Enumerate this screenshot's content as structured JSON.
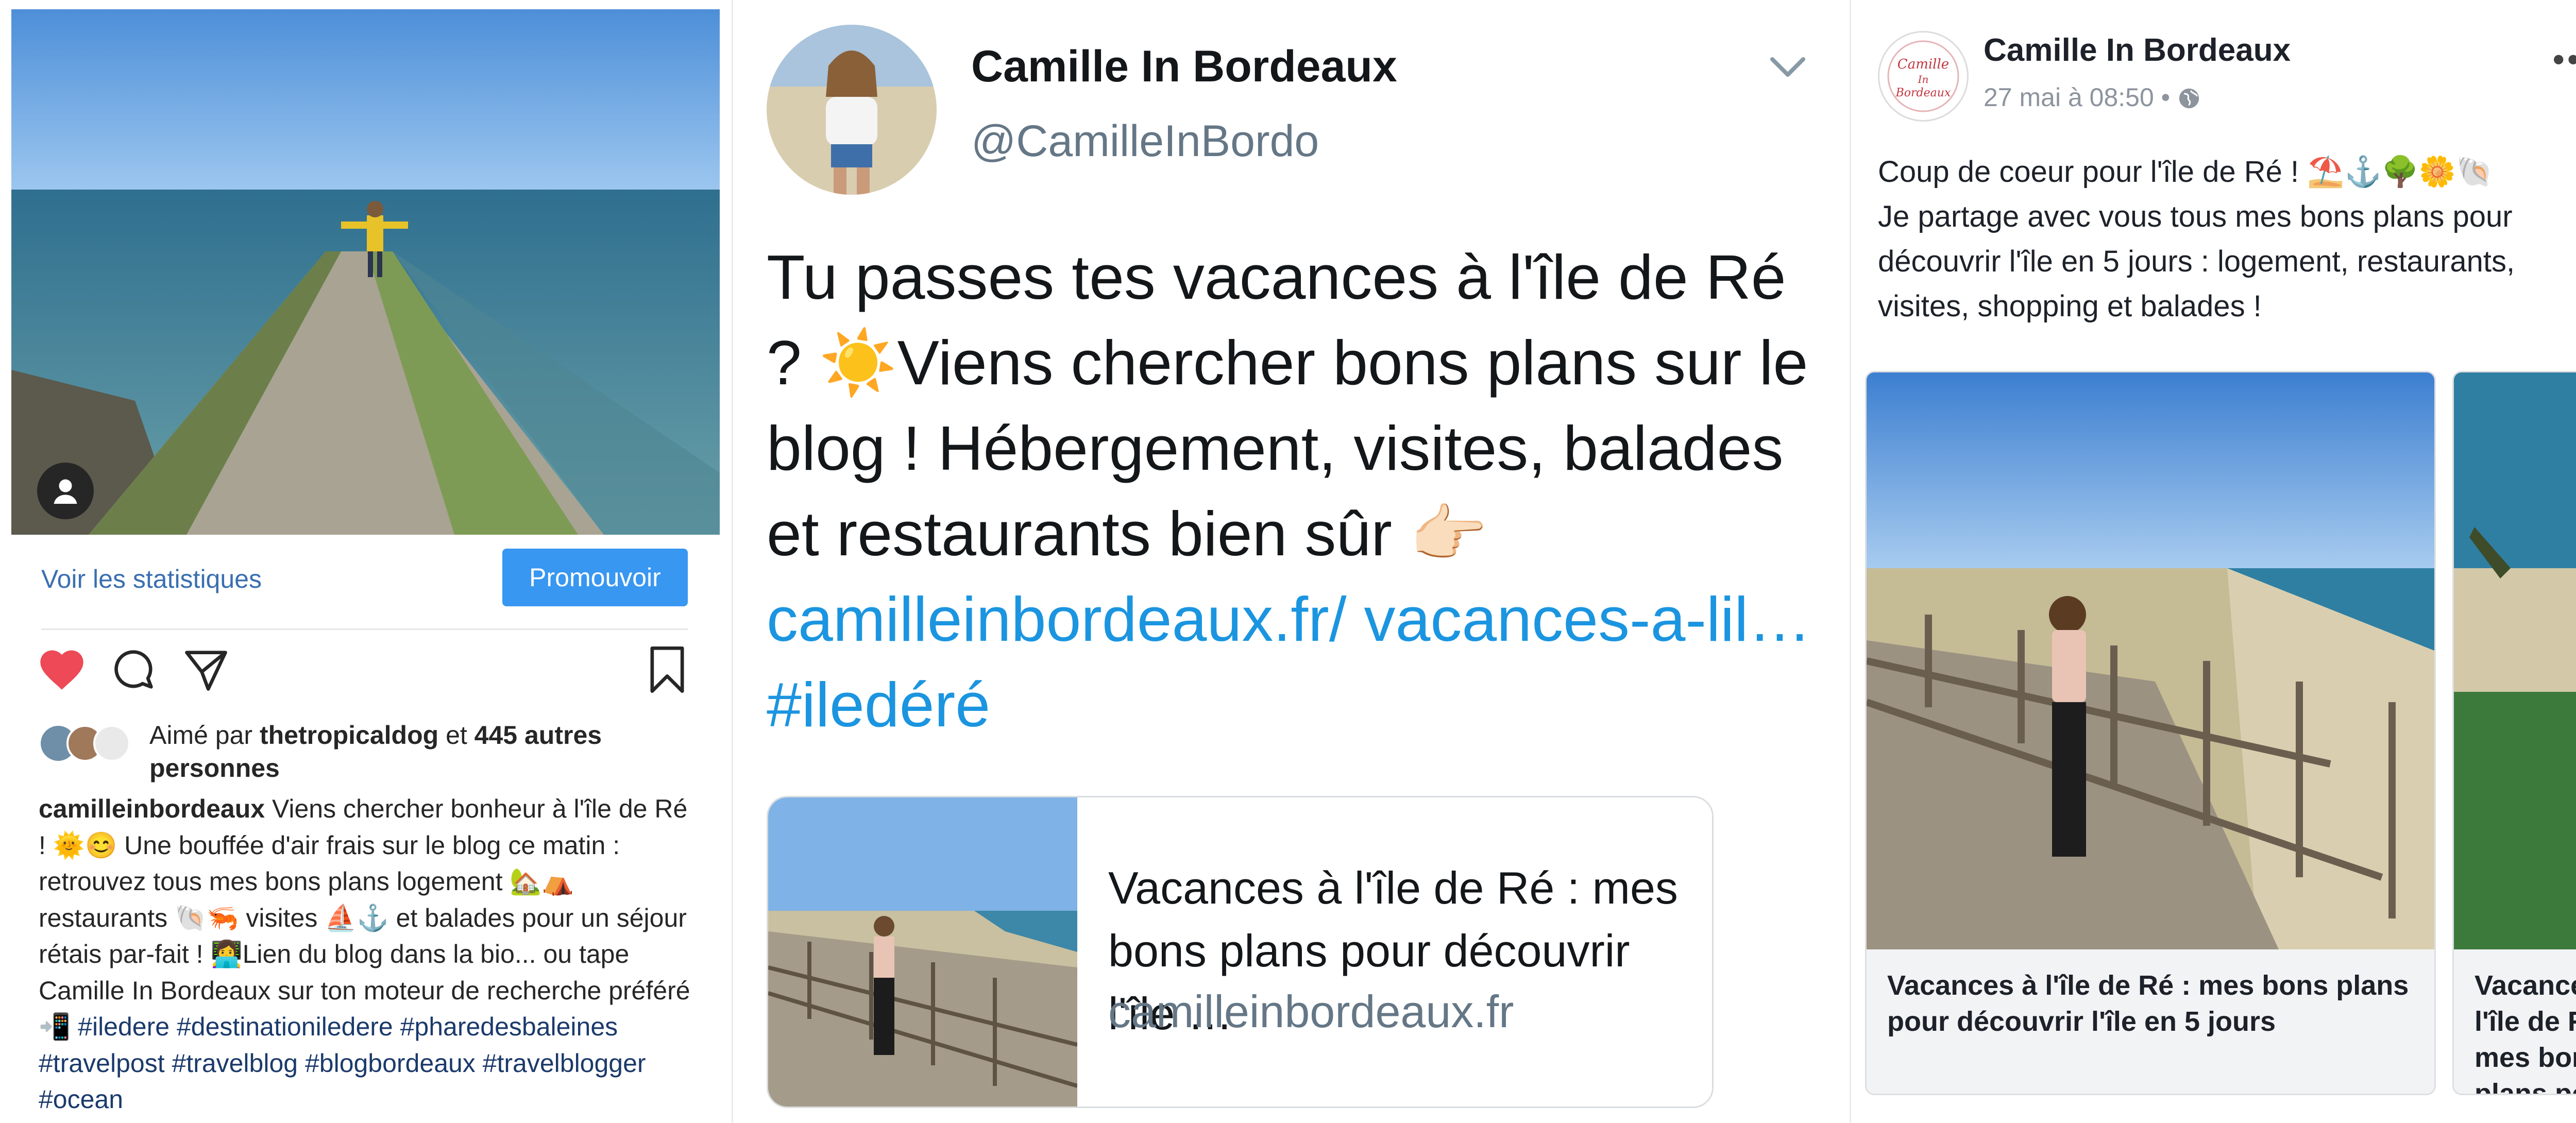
{
  "instagram": {
    "stats_link": "Voir les statistiques",
    "promote_button": "Promouvoir",
    "liked_prefix": "Aimé par ",
    "liked_user": "thetropicaldog",
    "liked_middle": " et ",
    "liked_others": "445 autres personnes",
    "caption_user": "camilleinbordeaux",
    "caption_text": " Viens chercher bonheur à l'île de Ré ! 🌞😊 Une bouffée d'air frais sur le blog ce matin : retrouvez tous mes bons plans logement 🏡⛺ restaurants 🐚🦐 visites ⛵⚓ et balades pour un séjour rétais par-fait ! 👩‍💻Lien du blog dans la bio... ou tape Camille In Bordeaux sur ton moteur de recherche préféré 📲 ",
    "caption_tags": "#iledere #destinationiledere #pharedesbaleines #travelpost #travelblog #blogbordeaux #travelblogger #ocean"
  },
  "twitter": {
    "name": "Camille In Bordeaux",
    "handle": "@CamilleInBordo",
    "tweet_text": "Tu passes tes vacances à l'île de Ré ? ☀️Viens chercher bons plans sur le blog ! Hébergement, visites, balades et restaurants bien sûr 👉🏻",
    "tweet_link": "camilleinbordeaux.fr/ vacances-a-lil… #iledéré",
    "card_title": "Vacances à l'île de Ré : mes bons plans pour découvrir l'île …",
    "card_domain": "camilleinbordeaux.fr"
  },
  "facebook": {
    "name": "Camille In Bordeaux",
    "timestamp": "27 mai à 08:50 • ",
    "globe_icon": "globe-icon",
    "more_icon": "•••",
    "avatar_logo_text": "Camille In Bordeaux",
    "post_text": "Coup de coeur pour l'île de Ré ! ⛱️⚓🌳🌼🐚\nJe partage avec vous tous mes bons plans pour découvrir l'île en 5 jours : logement, restaurants, visites, shopping et balades !",
    "card1_title": "Vacances à l'île de Ré : mes bons plans pour découvrir l'île en 5 jours",
    "card2_title": "Vacances à l'île de Ré : mes bons plans pour déco"
  },
  "colors": {
    "instagram_blue": "#3897f0",
    "like_red": "#ed4956",
    "twitter_link": "#1b95e0",
    "facebook_text": "#1d2129"
  }
}
